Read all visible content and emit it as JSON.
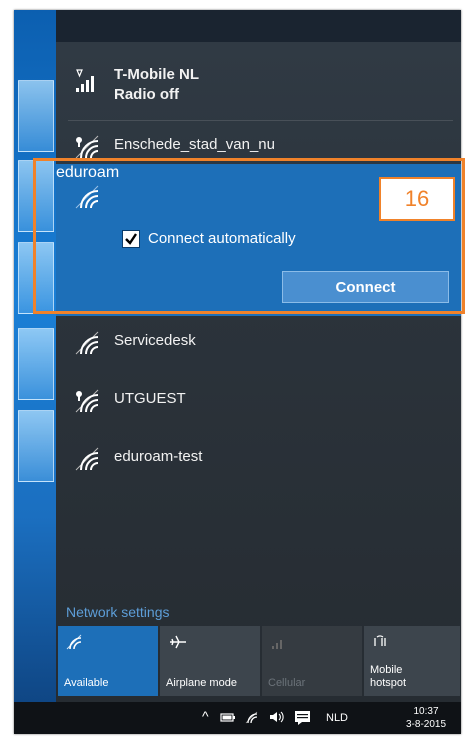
{
  "networks": {
    "cellular": {
      "name": "T-Mobile NL",
      "status": "Radio off"
    },
    "items": [
      {
        "name": "Enschede_stad_van_nu",
        "secured": false
      },
      {
        "name": "eduroam",
        "secured": true,
        "selected": true
      },
      {
        "name": "Servicedesk",
        "secured": true
      },
      {
        "name": "UTGUEST",
        "secured": false
      },
      {
        "name": "eduroam-test",
        "secured": true
      }
    ]
  },
  "selected_network": {
    "connect_automatically_label": "Connect automatically",
    "connect_automatically_checked": true,
    "connect_button_label": "Connect"
  },
  "annotation": {
    "number": "16",
    "color": "#f0822a"
  },
  "network_settings_link": "Network settings",
  "quick_actions": [
    {
      "label": "Available",
      "icon": "wifi-icon",
      "active": true
    },
    {
      "label": "Airplane mode",
      "icon": "airplane-icon",
      "active": false
    },
    {
      "label": "Cellular",
      "icon": "cellular-icon",
      "active": false,
      "disabled": true
    },
    {
      "label": "Mobile hotspot",
      "icon": "hotspot-icon",
      "active": false
    }
  ],
  "taskbar": {
    "language": "NLD",
    "time": "10:37",
    "date": "3-8-2015"
  },
  "colors": {
    "accent": "#1d6fb8",
    "flyout_bg": "#2b333b",
    "link": "#5d9ed8"
  }
}
